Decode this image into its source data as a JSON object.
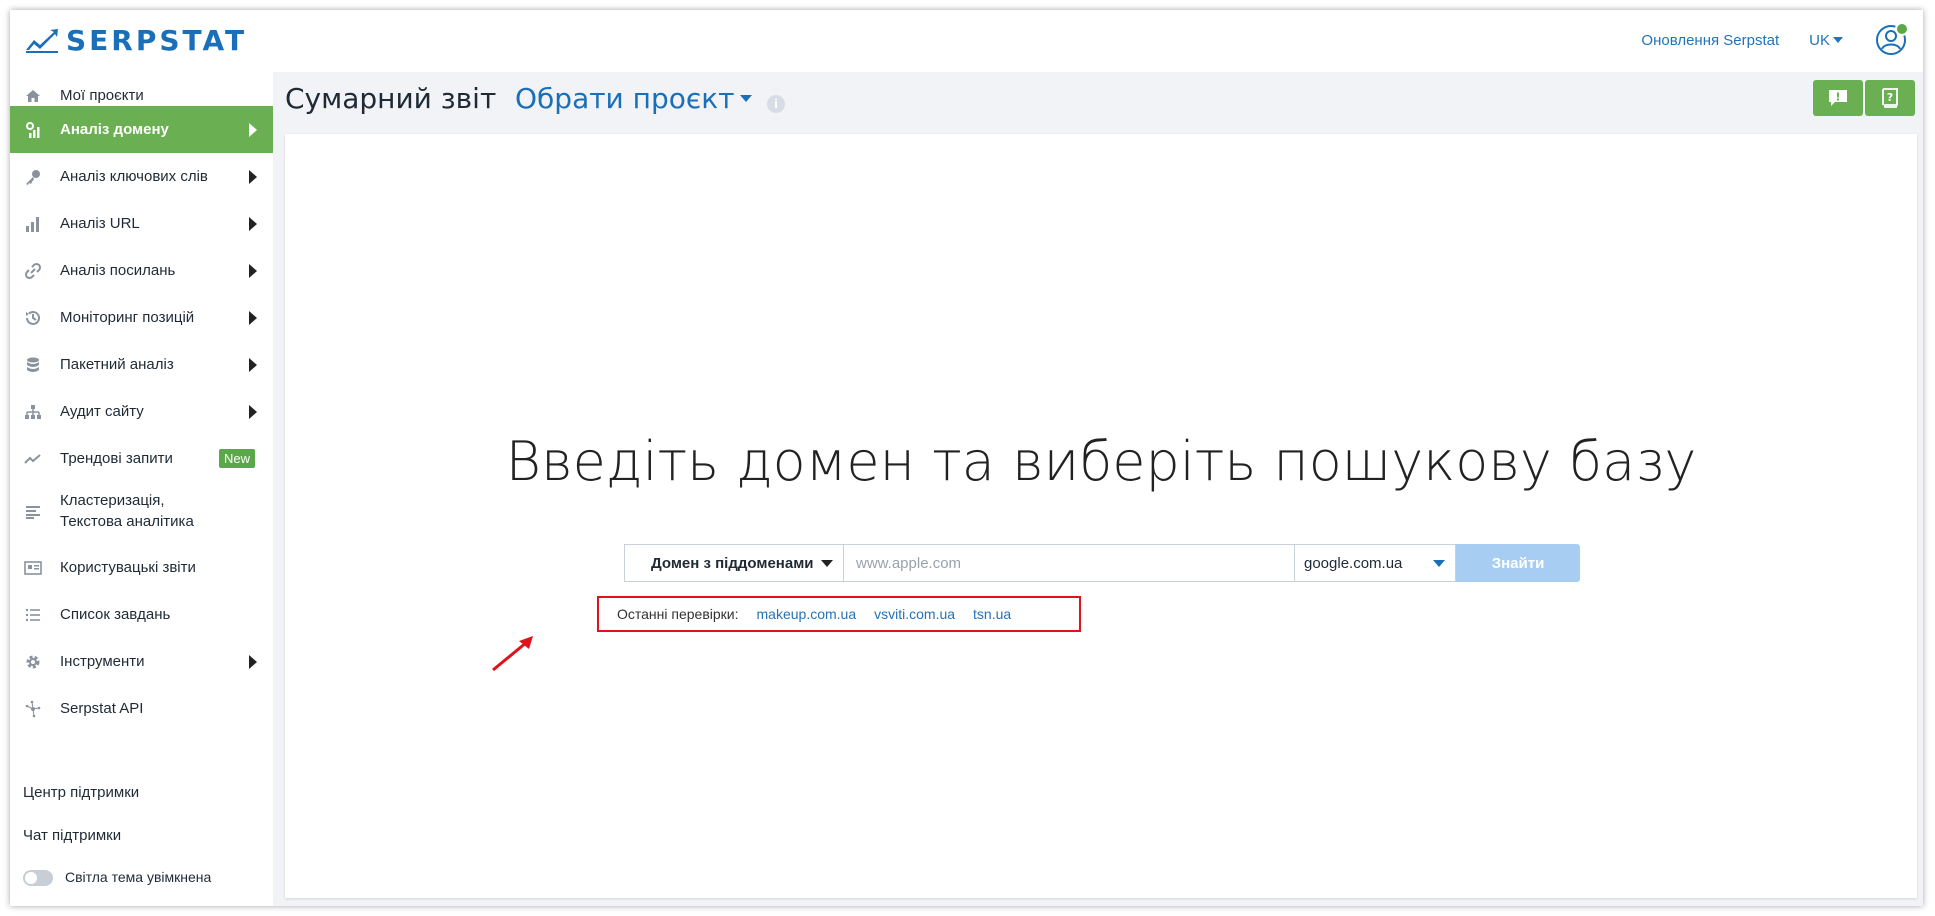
{
  "app": {
    "logo_text": "SERPSTAT",
    "update_link": "Оновлення Serpstat",
    "language": "UK"
  },
  "sidebar": {
    "items": [
      {
        "label": "Мої проєкти",
        "icon": "home-icon"
      },
      {
        "label": "Аналіз домену",
        "icon": "domain-analysis-icon",
        "active": true
      },
      {
        "label": "Аналіз ключових слів",
        "icon": "key-icon"
      },
      {
        "label": "Аналіз URL",
        "icon": "bar-chart-icon"
      },
      {
        "label": "Аналіз посилань",
        "icon": "link-icon"
      },
      {
        "label": "Моніторинг позицій",
        "icon": "history-icon"
      },
      {
        "label": "Пакетний аналіз",
        "icon": "database-icon"
      },
      {
        "label": "Аудит сайту",
        "icon": "sitemap-icon"
      },
      {
        "label": "Трендові запити",
        "icon": "trend-icon",
        "badge": "New"
      },
      {
        "label": "Кластеризація,",
        "label2": "Текстова аналітика",
        "icon": "cluster-icon"
      },
      {
        "label": "Користувацькі звіти",
        "icon": "report-icon"
      },
      {
        "label": "Список завдань",
        "icon": "list-icon"
      },
      {
        "label": "Інструменти",
        "icon": "gear-icon"
      },
      {
        "label": "Serpstat API",
        "icon": "api-icon"
      }
    ],
    "support_center": "Центр підтримки",
    "support_chat": "Чат підтримки",
    "theme_toggle": "Світла тема увімкнена"
  },
  "header": {
    "title": "Сумарний звіт",
    "project_picker": "Обрати проєкт"
  },
  "main": {
    "headline": "Введіть домен та виберіть пошукову базу",
    "search": {
      "mode": "Домен з піддоменами",
      "placeholder": "www.apple.com",
      "database": "google.com.ua",
      "button": "Знайти"
    },
    "recent": {
      "label": "Останні перевірки:",
      "items": [
        "makeup.com.ua",
        "vsviti.com.ua",
        "tsn.ua"
      ]
    }
  },
  "colors": {
    "brand_blue": "#1a6fb8",
    "active_green": "#6aaf52",
    "highlight_red": "#e0121b"
  }
}
